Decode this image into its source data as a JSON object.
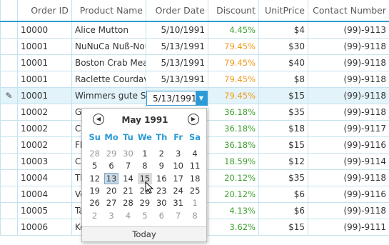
{
  "columns": [
    "Order ID",
    "Product Name",
    "Order Date",
    "Discount",
    "UnitPrice",
    "Contact Number"
  ],
  "rows": [
    [
      "10000",
      "Alice Mutton",
      "5/10/1991",
      "4.45%",
      "$4",
      "(99)-9113"
    ],
    [
      "10001",
      "NuNuCa Nuß-Nou",
      "5/13/1991",
      "79.45%",
      "$30",
      "(99)-9118"
    ],
    [
      "10001",
      "Boston Crab Meat",
      "5/13/1991",
      "79.45%",
      "$40",
      "(99)-9118"
    ],
    [
      "10001",
      "Raclette Courdave",
      "5/13/1991",
      "79.45%",
      "$8",
      "(99)-9118"
    ],
    [
      "10001",
      "Wimmers gute Se",
      "",
      "79.45%",
      "$15",
      "(99)-9118"
    ],
    [
      "10002",
      "G",
      "",
      "36.18%",
      "$35",
      "(99)-9118"
    ],
    [
      "10002",
      "Cl",
      "",
      "36.18%",
      "$18",
      "(99)-9117"
    ],
    [
      "10002",
      "Fl",
      "",
      "36.18%",
      "$15",
      "(99)-9116"
    ],
    [
      "10003",
      "Ca",
      "",
      "18.59%",
      "$12",
      "(99)-9114"
    ],
    [
      "10004",
      "Th",
      "",
      "20.12%",
      "$35",
      "(99)-9118"
    ],
    [
      "10004",
      "Ve",
      "",
      "20.12%",
      "$6",
      "(99)-9116"
    ],
    [
      "10005",
      "Ta",
      "",
      "4.13%",
      "$6",
      "(99)-9118"
    ],
    [
      "10006",
      "Ko",
      "",
      "3.62%",
      "$15",
      "(99)-9111"
    ]
  ],
  "row_indicator": "✎",
  "editor": {
    "value": "5/13/1991"
  },
  "calendar": {
    "title": "May 1991",
    "day_names": [
      "Su",
      "Mo",
      "Tu",
      "We",
      "Th",
      "Fr",
      "Sa"
    ],
    "weeks": [
      [
        "28",
        "29",
        "30",
        "1",
        "2",
        "3",
        "4"
      ],
      [
        "5",
        "6",
        "7",
        "8",
        "9",
        "10",
        "11"
      ],
      [
        "12",
        "13",
        "14",
        "15",
        "16",
        "17",
        "18"
      ],
      [
        "19",
        "20",
        "21",
        "22",
        "23",
        "24",
        "25"
      ],
      [
        "26",
        "27",
        "28",
        "29",
        "30",
        "31",
        "1"
      ],
      [
        "2",
        "3",
        "4",
        "5",
        "6",
        "7",
        "8"
      ]
    ],
    "selected": "13",
    "hovered": "15",
    "today_label": "Today"
  },
  "colors": {
    "accent": "#2b9bd6",
    "discount_green": "#3b9f2b",
    "discount_orange": "#f09a1a"
  }
}
